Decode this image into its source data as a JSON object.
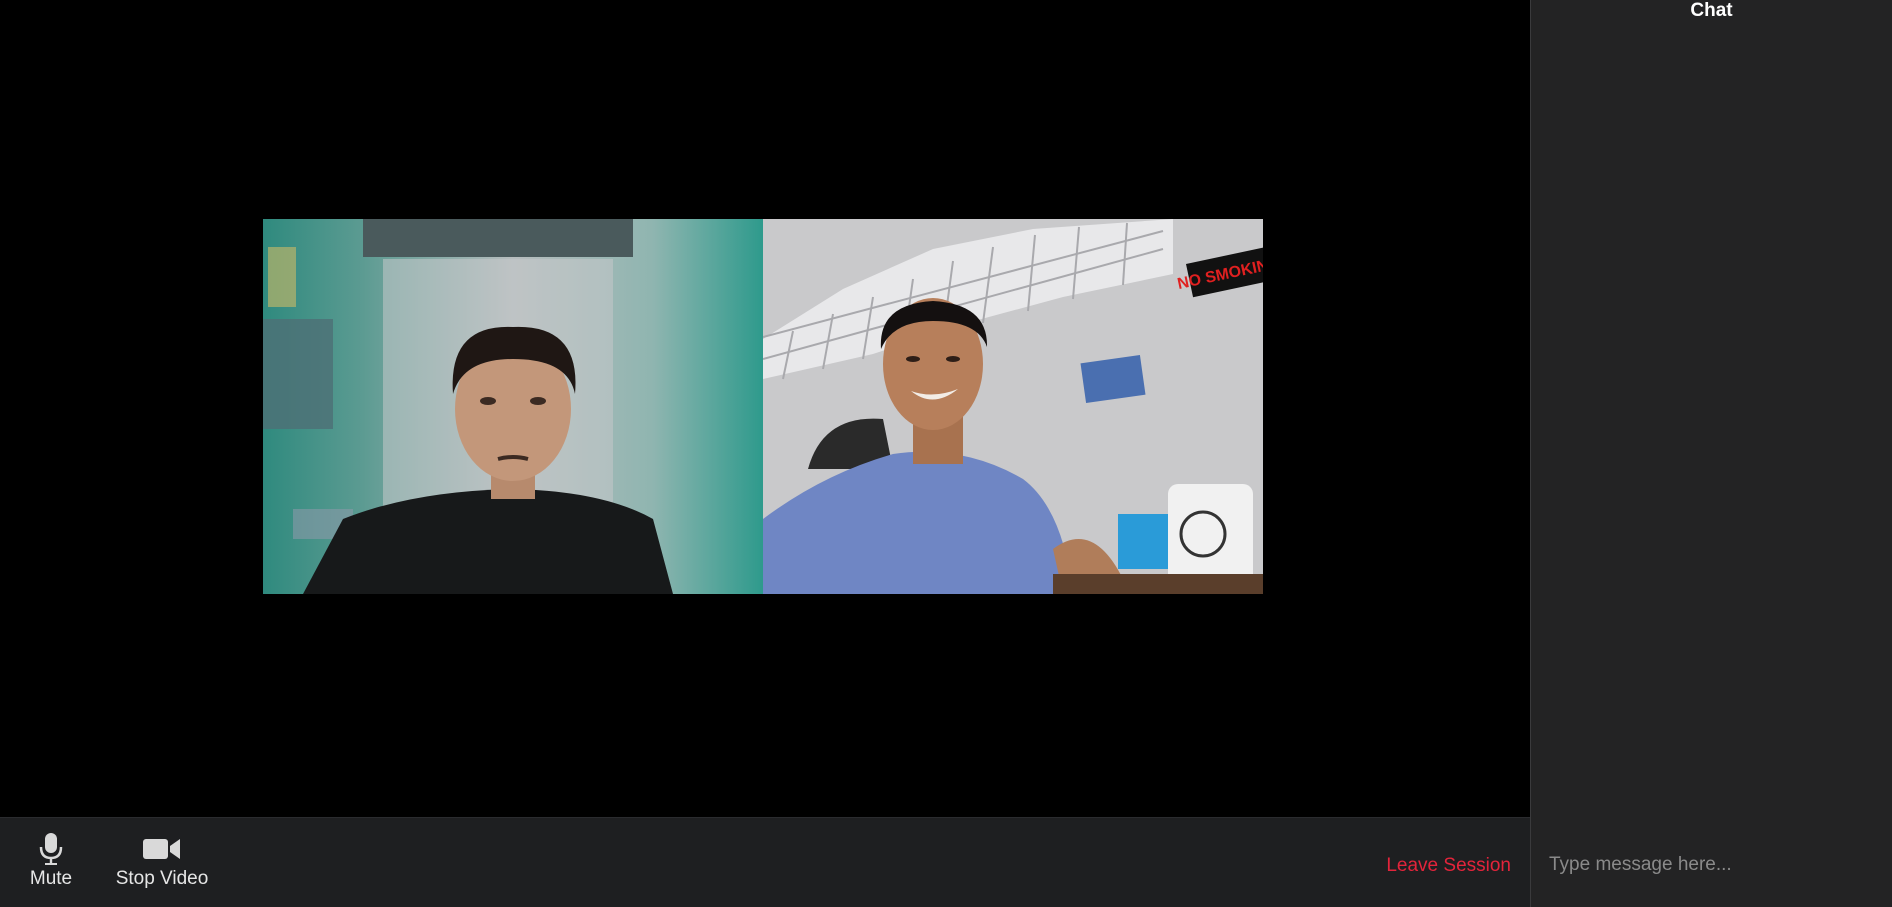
{
  "toolbar": {
    "mute_label": "Mute",
    "mute_icon": "microphone-icon",
    "video_label": "Stop Video",
    "video_icon": "video-camera-icon",
    "leave_label": "Leave Session",
    "leave_color": "#e3243b"
  },
  "chat": {
    "title": "Chat",
    "input_placeholder": "Type message here..."
  },
  "video": {
    "tiles": [
      {
        "participant": "participant-1"
      },
      {
        "participant": "participant-2",
        "sign_text": "NO SMOKING"
      }
    ]
  }
}
